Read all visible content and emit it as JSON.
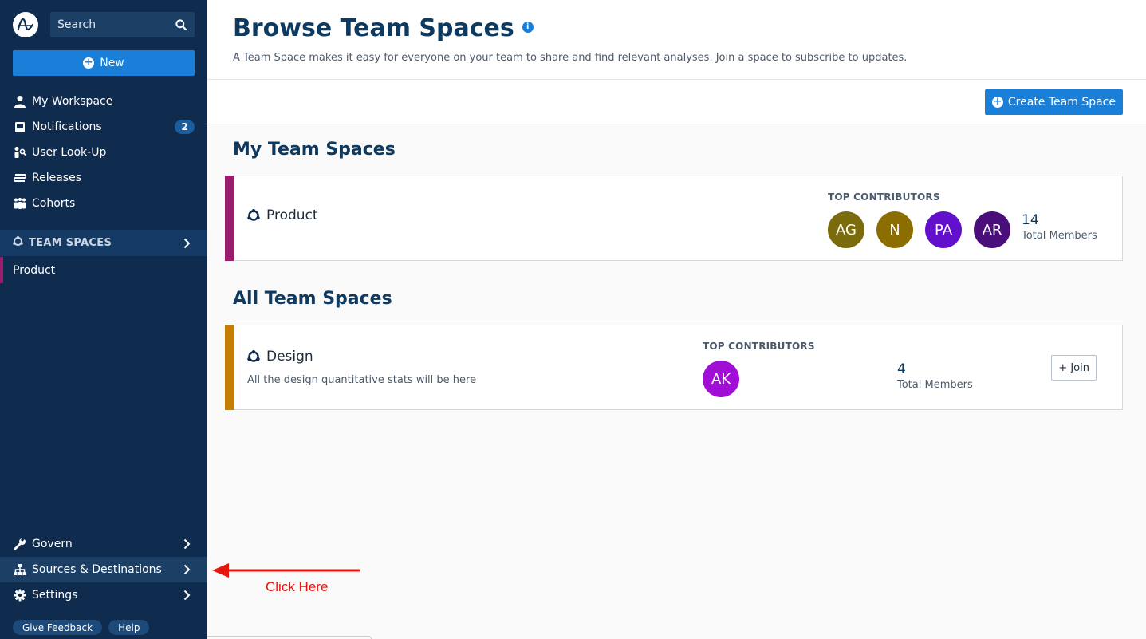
{
  "sidebar": {
    "search_placeholder": "Search",
    "new_label": "New",
    "nav_items": [
      {
        "label": "My Workspace",
        "icon": "user-icon"
      },
      {
        "label": "Notifications",
        "icon": "inbox-icon",
        "badge": "2"
      },
      {
        "label": "User Look-Up",
        "icon": "user-lookup-icon"
      },
      {
        "label": "Releases",
        "icon": "releases-icon"
      },
      {
        "label": "Cohorts",
        "icon": "cohorts-icon"
      }
    ],
    "team_spaces_header": "TEAM SPACES",
    "team_spaces": [
      {
        "label": "Product",
        "color": "#9b1b6c"
      }
    ],
    "bottom_items": [
      {
        "label": "Govern",
        "icon": "wrench-icon"
      },
      {
        "label": "Sources & Destinations",
        "icon": "sitemap-icon"
      },
      {
        "label": "Settings",
        "icon": "gear-icon"
      }
    ],
    "footer": {
      "feedback": "Give Feedback",
      "help": "Help"
    }
  },
  "header": {
    "title": "Browse Team Spaces",
    "subtitle": "A Team Space makes it easy for everyone on your team to share and find relevant analyses. Join a space to subscribe to updates.",
    "create_label": "Create Team Space"
  },
  "my_team_spaces": {
    "title": "My Team Spaces",
    "cards": [
      {
        "name": "Product",
        "stripe_color": "#9b1b6c",
        "top_contributors_label": "TOP CONTRIBUTORS",
        "avatars": [
          {
            "initials": "AG",
            "color": "#7a6b0d"
          },
          {
            "initials": "N",
            "color": "#8c6d00"
          },
          {
            "initials": "PA",
            "color": "#6210cc"
          },
          {
            "initials": "AR",
            "color": "#4a0e7a"
          }
        ],
        "member_count": "14",
        "members_label": "Total Members"
      }
    ]
  },
  "all_team_spaces": {
    "title": "All Team Spaces",
    "cards": [
      {
        "name": "Design",
        "description": "All the design quantitative stats will be here",
        "stripe_color": "#c47f00",
        "top_contributors_label": "TOP CONTRIBUTORS",
        "avatars": [
          {
            "initials": "AK",
            "color": "#a10fd6"
          }
        ],
        "member_count": "4",
        "members_label": "Total Members",
        "join_label": "+ Join"
      }
    ]
  },
  "annotation": {
    "text": "Click Here",
    "color": "#e8150c"
  }
}
